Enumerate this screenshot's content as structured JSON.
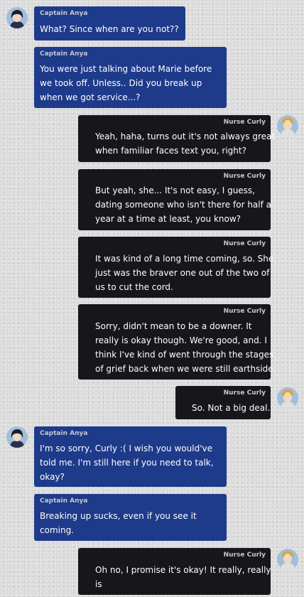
{
  "chat": {
    "messages": [
      {
        "sender": "Captain Anya",
        "lines": [
          "What? Since when are you not??"
        ]
      },
      {
        "sender": "Captain Anya",
        "lines": [
          "You were just talking about Marie before",
          "we took off. Unless.. Did you break up",
          "when we got service...?"
        ]
      },
      {
        "sender": "Nurse Curly",
        "lines": [
          "Yeah, haha, turns out it's not always great",
          "when familiar faces text you, right?"
        ]
      },
      {
        "sender": "Nurse Curly",
        "lines": [
          "But yeah, she... It's not easy, I guess,",
          "dating someone who isn't there for half a",
          "year at a time at least, you know?"
        ]
      },
      {
        "sender": "Nurse Curly",
        "lines": [
          "It was kind of a long time coming, so. She",
          "just was the braver one out of the two of",
          "us to cut the cord."
        ]
      },
      {
        "sender": "Nurse Curly",
        "lines": [
          "Sorry, didn't mean to be a downer. It",
          "really is okay though. We're good, and. I",
          "think I've kind of went through the stages",
          "of grief back when we were still earthside."
        ]
      },
      {
        "sender": "Nurse Curly",
        "lines": [
          "So. Not a big deal."
        ]
      },
      {
        "sender": "Captain Anya",
        "lines": [
          "I'm so sorry, Curly :( I wish you would've",
          "told me. I'm still here if you need to talk,",
          "okay?"
        ]
      },
      {
        "sender": "Captain Anya",
        "lines": [
          "Breaking up sucks, even if you see it",
          "coming."
        ]
      },
      {
        "sender": "Nurse Curly",
        "lines": [
          "Oh no, I promise it's okay! It really, really",
          "is"
        ]
      }
    ],
    "avatars": [
      {
        "name": "captain-anya-avatar"
      },
      {
        "name": "nurse-curly-avatar"
      },
      {
        "name": "nurse-curly-avatar"
      },
      {
        "name": "captain-anya-avatar"
      },
      {
        "name": "nurse-curly-avatar"
      }
    ],
    "colors": {
      "anya_bubble": "#1e3a8a",
      "curly_bubble": "#17171b",
      "sender_label": "#c4c7cf",
      "message_text": "#ffffff",
      "background": "#d9d9d9"
    }
  }
}
